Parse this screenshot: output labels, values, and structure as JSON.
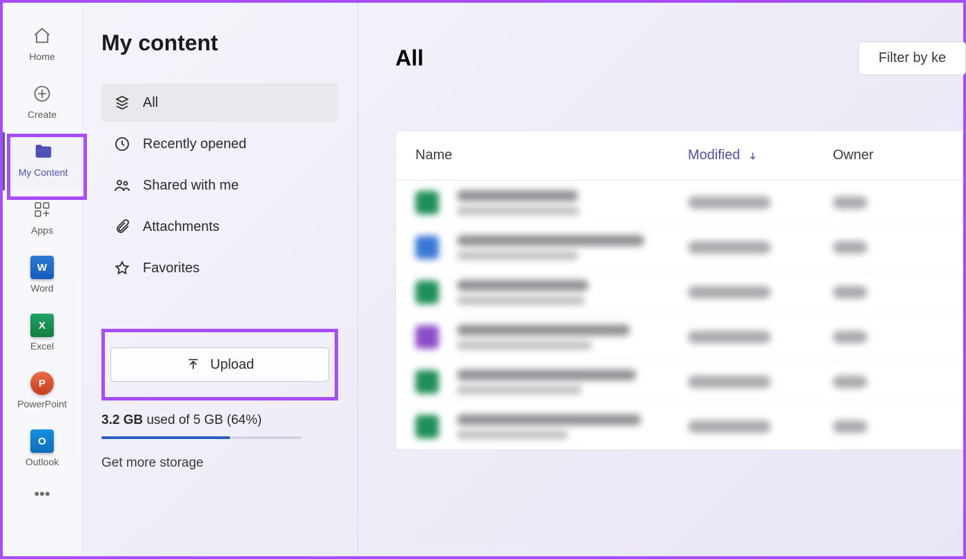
{
  "rail": {
    "items": [
      {
        "id": "home",
        "label": "Home"
      },
      {
        "id": "create",
        "label": "Create"
      },
      {
        "id": "my-content",
        "label": "My Content",
        "active": true
      },
      {
        "id": "apps",
        "label": "Apps"
      },
      {
        "id": "word",
        "label": "Word"
      },
      {
        "id": "excel",
        "label": "Excel"
      },
      {
        "id": "powerpoint",
        "label": "PowerPoint"
      },
      {
        "id": "outlook",
        "label": "Outlook"
      }
    ]
  },
  "panel": {
    "title": "My content",
    "nav": [
      {
        "id": "all",
        "label": "All",
        "active": true
      },
      {
        "id": "recent",
        "label": "Recently opened"
      },
      {
        "id": "shared",
        "label": "Shared with me"
      },
      {
        "id": "attach",
        "label": "Attachments"
      },
      {
        "id": "fav",
        "label": "Favorites"
      }
    ],
    "upload_label": "Upload",
    "storage": {
      "used": "3.2 GB",
      "suffix": " used of 5 GB (64%)",
      "percent": 64,
      "more_link": "Get more storage"
    }
  },
  "main": {
    "heading": "All",
    "filter_label": "Filter by ke",
    "columns": {
      "name": "Name",
      "modified": "Modified",
      "owner": "Owner"
    },
    "rows_blurred_count": 6,
    "row_icon_colors": [
      "#1e8f57",
      "#3a78d6",
      "#1e8f57",
      "#8c4cc9",
      "#1e8f57",
      "#1e8f57"
    ]
  },
  "highlights": {
    "rail_my_content": true,
    "upload_button": true
  }
}
